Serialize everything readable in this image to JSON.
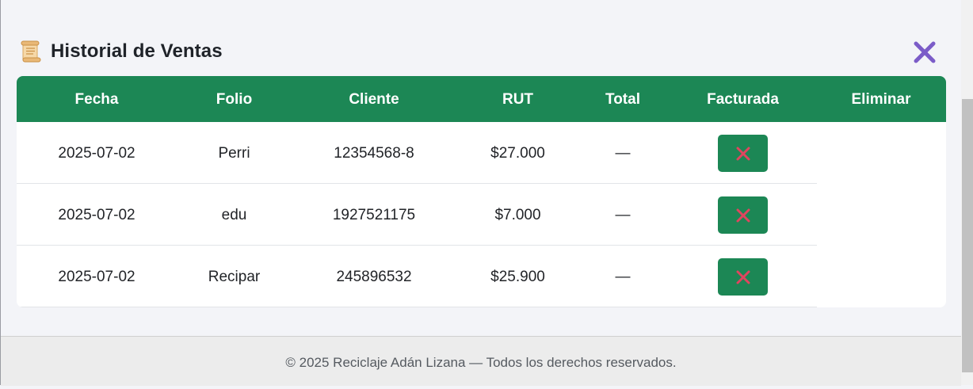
{
  "modal": {
    "title": "Historial de Ventas",
    "title_icon": "scroll-icon",
    "close_icon": "close-x-icon",
    "close_color": "#7b5cc8"
  },
  "table": {
    "header_color": "#1c8755",
    "columns": [
      "Fecha",
      "Folio",
      "Cliente",
      "RUT",
      "Total",
      "Facturada",
      "Eliminar"
    ],
    "rows": [
      {
        "fecha": "2025-07-02",
        "folio": "Perri",
        "cliente": "12354568-8",
        "rut": "$27.000",
        "total": "—",
        "facturada_icon": "x-mark-icon"
      },
      {
        "fecha": "2025-07-02",
        "folio": "edu",
        "cliente": "1927521175",
        "rut": "$7.000",
        "total": "—",
        "facturada_icon": "x-mark-icon"
      },
      {
        "fecha": "2025-07-02",
        "folio": "Recipar",
        "cliente": "245896532",
        "rut": "$25.900",
        "total": "—",
        "facturada_icon": "x-mark-icon"
      }
    ],
    "x_mark_color": "#e0455f"
  },
  "footer": {
    "text": "© 2025 Reciclaje Adán Lizana — Todos los derechos reservados."
  }
}
